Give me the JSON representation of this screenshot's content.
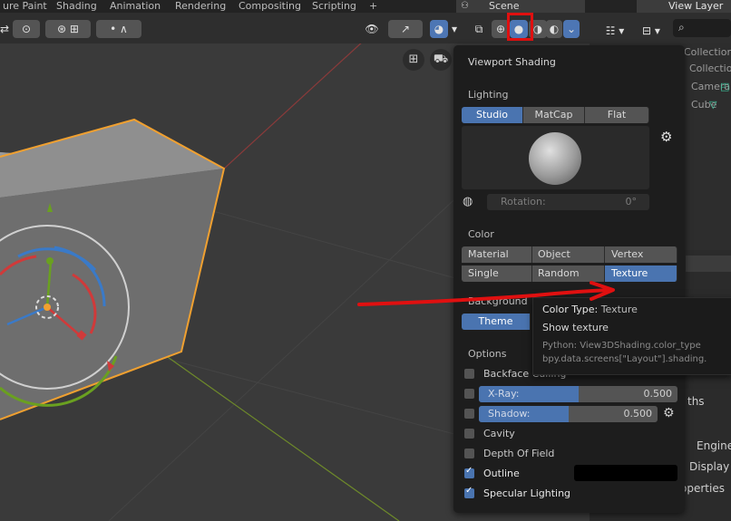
{
  "tabs": [
    "ure Paint",
    "Shading",
    "Animation",
    "Rendering",
    "Compositing",
    "Scripting",
    "+"
  ],
  "scene_label": "Scene",
  "view_layer_label": "View Layer",
  "outliner_items": [
    "Collection",
    "Collection",
    "Camera",
    "Cube"
  ],
  "popover": {
    "title": "Viewport Shading",
    "lighting_label": "Lighting",
    "lighting_options": [
      "Studio",
      "MatCap",
      "Flat"
    ],
    "lighting_selected": "Studio",
    "rotation_label": "Rotation:",
    "rotation_value": "0°",
    "color_label": "Color",
    "color_options_row1": [
      "Material",
      "Object",
      "Vertex"
    ],
    "color_options_row2": [
      "Single",
      "Random",
      "Texture"
    ],
    "color_selected": "Texture",
    "background_label": "Background",
    "background_option": "Theme",
    "options_label": "Options",
    "backface_culling": "Backface Culling",
    "xray_label": "X-Ray:",
    "xray_value": "0.500",
    "xray_fraction": 0.5,
    "shadow_label": "Shadow:",
    "shadow_value": "0.500",
    "shadow_fraction": 0.5,
    "cavity": "Cavity",
    "depth_of_field": "Depth Of Field",
    "outline": "Outline",
    "specular_lighting": "Specular Lighting"
  },
  "tooltip": {
    "heading": "Color Type:",
    "heading_value": "Texture",
    "description": "Show texture",
    "python_line1": "Python: View3DShading.color_type",
    "python_line2": "bpy.data.screens[\"Layout\"].shading."
  },
  "props_fragments": [
    "ths",
    "Engine: C",
    "Display",
    "operties"
  ],
  "colors": {
    "accent_blue": "#4a74b0",
    "annotation_red": "#e01010",
    "cube_outline": "#f0a030"
  }
}
